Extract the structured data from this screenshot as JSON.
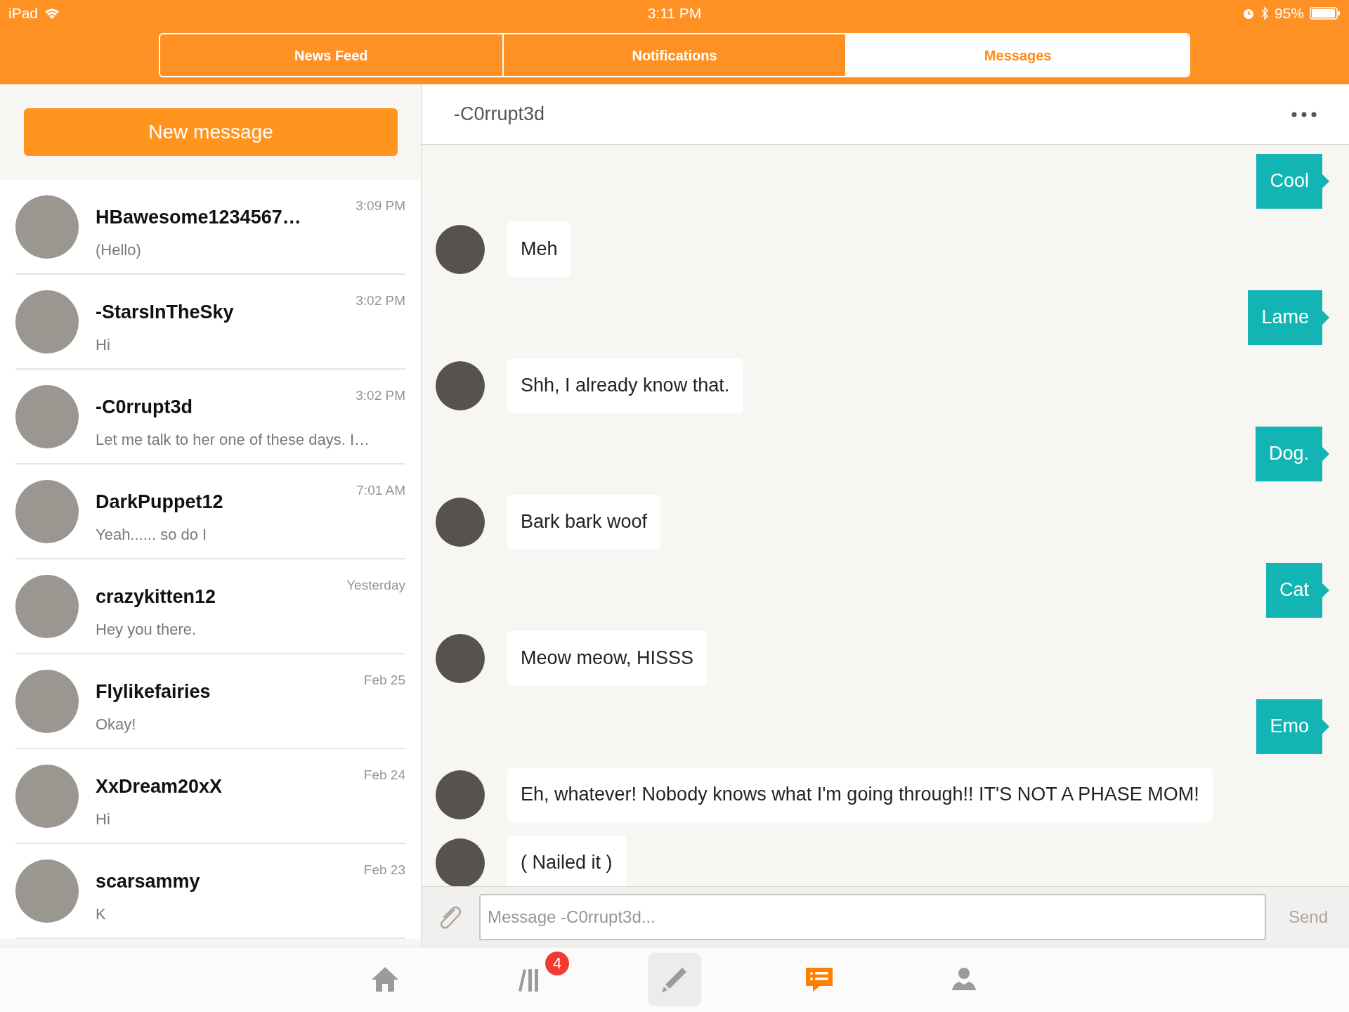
{
  "status_bar": {
    "device": "iPad",
    "time": "3:11 PM",
    "battery": "95%"
  },
  "top_tabs": [
    {
      "label": "News Feed",
      "selected": false
    },
    {
      "label": "Notifications",
      "selected": false
    },
    {
      "label": "Messages",
      "selected": true
    }
  ],
  "new_message_button": "New message",
  "conversations": [
    {
      "name": "HBawesome1234567…",
      "preview": "(Hello)",
      "time": "3:09 PM"
    },
    {
      "name": "-StarsInTheSky",
      "preview": "Hi",
      "time": "3:02 PM"
    },
    {
      "name": "-C0rrupt3d",
      "preview": "Let me talk to her one of these days. I…",
      "time": "3:02 PM"
    },
    {
      "name": "DarkPuppet12",
      "preview": "Yeah...... so do I",
      "time": "7:01 AM"
    },
    {
      "name": "crazykitten12",
      "preview": "Hey you there.",
      "time": "Yesterday"
    },
    {
      "name": "Flylikefairies",
      "preview": "Okay!",
      "time": "Feb 25"
    },
    {
      "name": "XxDream20xX",
      "preview": "Hi",
      "time": "Feb 24"
    },
    {
      "name": "scarsammy",
      "preview": "K",
      "time": "Feb 23"
    }
  ],
  "chat": {
    "title": "-C0rrupt3d",
    "messages": [
      {
        "kind": "sent",
        "text": "Cool"
      },
      {
        "kind": "received",
        "text": "Meh"
      },
      {
        "kind": "sent",
        "text": "Lame"
      },
      {
        "kind": "received",
        "text": "Shh, I already know that."
      },
      {
        "kind": "sent",
        "text": "Dog."
      },
      {
        "kind": "received",
        "text": "Bark bark woof"
      },
      {
        "kind": "sent",
        "text": "Cat"
      },
      {
        "kind": "received",
        "text": "Meow meow, HISSS"
      },
      {
        "kind": "sent",
        "text": "Emo"
      },
      {
        "kind": "received",
        "text": "Eh, whatever! Nobody knows what I'm going through!! IT'S NOT A PHASE MOM!"
      },
      {
        "kind": "received",
        "text": "( Nailed it )"
      }
    ],
    "input": {
      "placeholder": "Message -C0rrupt3d..."
    },
    "send": "Send"
  },
  "bottom_tabs": [
    {
      "kind": "home",
      "selected": false
    },
    {
      "kind": "library",
      "selected": false,
      "badge": "4"
    },
    {
      "kind": "compose",
      "selected": false
    },
    {
      "kind": "messages",
      "selected": true
    },
    {
      "kind": "profile",
      "selected": false
    }
  ]
}
